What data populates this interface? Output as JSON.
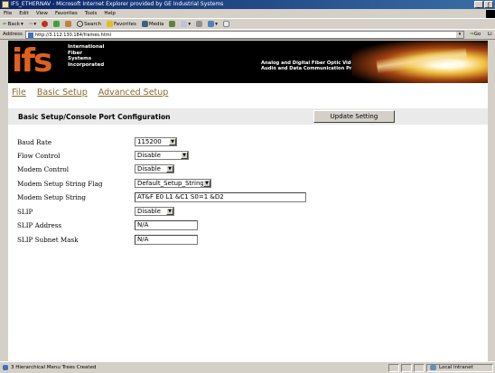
{
  "window": {
    "title": "IFS_ETHERNAV - Microsoft Internet Explorer provided by GE Industrial Systems",
    "buttons": [
      "_",
      "ʃ"
    ]
  },
  "menubar": [
    "File",
    "Edit",
    "View",
    "Favorites",
    "Tools",
    "Help"
  ],
  "toolbar": {
    "back": "Back",
    "search": "Search",
    "favorites": "Favorites",
    "media": "Media"
  },
  "address": {
    "label": "Address",
    "url": "http://3.112.130.184/frames.html",
    "go": "Go",
    "links": "Li"
  },
  "banner": {
    "logo": "ifs",
    "company_lines": [
      "International",
      "Fiber",
      "Systems",
      "Incorporated"
    ],
    "tagline_lines": [
      "Analog and Digital Fiber Optic Video",
      "Audio and Data Communication Products"
    ]
  },
  "nav": [
    "File",
    "Basic Setup",
    "Advanced Setup"
  ],
  "form": {
    "title": "Basic Setup/Console Port Configuration",
    "update_button": "Update Setting",
    "fields": [
      {
        "label": "Baud Rate",
        "value": "115200",
        "kind": "select"
      },
      {
        "label": "Flow Control",
        "value": "Disable",
        "kind": "select"
      },
      {
        "label": "Modem Control",
        "value": "Disable",
        "kind": "select"
      },
      {
        "label": "Modem Setup String Flag",
        "value": "Default_Setup_String",
        "kind": "select"
      },
      {
        "label": "Modem Setup String",
        "value": "AT&F E0 L1 &C1 S0=1 &D2",
        "kind": "text"
      },
      {
        "label": "SLIP",
        "value": "Disable",
        "kind": "select"
      },
      {
        "label": "SLIP Address",
        "value": "N/A",
        "kind": "text"
      },
      {
        "label": "SLIP Subnet Mask",
        "value": "N/A",
        "kind": "text"
      }
    ]
  },
  "status": {
    "message": "3 Hierarchical Menu Trees Created",
    "zone": "Local intranet"
  },
  "colors": {
    "titlebar": "#0a246a",
    "nav_link": "#8a6a2a",
    "logo": "#e06020"
  }
}
